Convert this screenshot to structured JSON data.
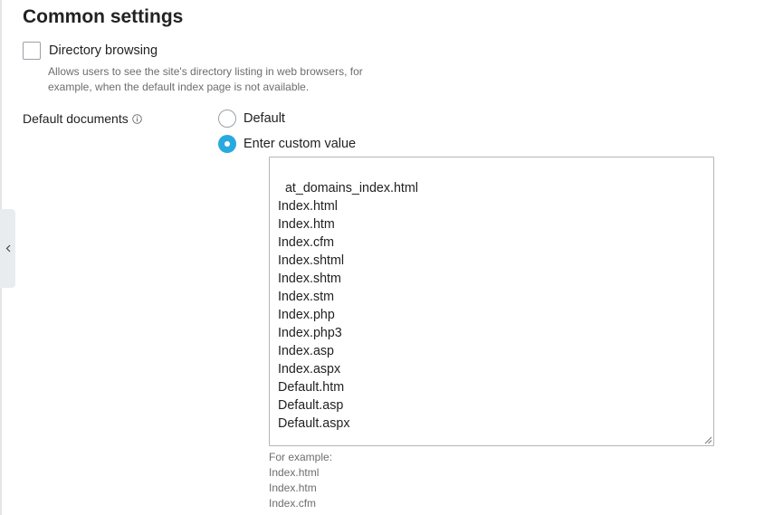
{
  "section": {
    "title": "Common settings"
  },
  "directory_browsing": {
    "label": "Directory browsing",
    "checked": false,
    "hint": "Allows users to see the site's directory listing in web browsers, for example, when the default index page is not available."
  },
  "default_documents": {
    "label": "Default documents",
    "options": [
      {
        "label": "Default",
        "selected": false
      },
      {
        "label": "Enter custom value",
        "selected": true
      }
    ],
    "value": "at_domains_index.html\nIndex.html\nIndex.htm\nIndex.cfm\nIndex.shtml\nIndex.shtm\nIndex.stm\nIndex.php\nIndex.php3\nIndex.asp\nIndex.aspx\nDefault.htm\nDefault.asp\nDefault.aspx",
    "example_title": "For example:",
    "examples": [
      "Index.html",
      "Index.htm",
      "Index.cfm"
    ]
  },
  "icons": {
    "collapse": "chevron-left-icon",
    "info": "info-icon",
    "resize": "resize-grip-icon"
  },
  "colors": {
    "accent": "#28aade"
  }
}
